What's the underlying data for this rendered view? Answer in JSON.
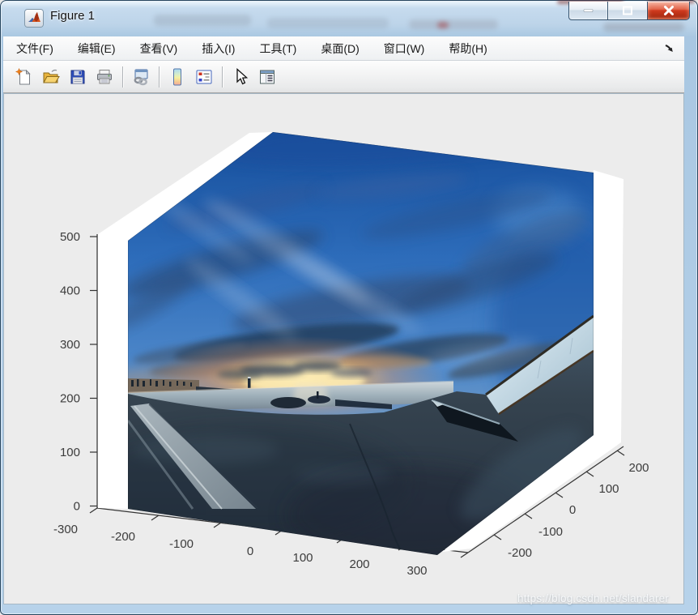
{
  "window": {
    "title": "Figure 1",
    "controls": [
      "minimize",
      "maximize",
      "close"
    ]
  },
  "menu": {
    "items": [
      "文件(F)",
      "编辑(E)",
      "查看(V)",
      "插入(I)",
      "工具(T)",
      "桌面(D)",
      "窗口(W)",
      "帮助(H)"
    ],
    "overflow_arrow": "↘"
  },
  "toolbar": {
    "icons": [
      "new-figure",
      "open-file",
      "save-figure",
      "print-figure",
      "link-plot",
      "insert-colorbar",
      "insert-legend",
      "edit-plot",
      "property-inspector"
    ]
  },
  "figure": {
    "view": "3d-surface-with-photo-texture",
    "axes": {
      "z_ticks": [
        "0",
        "100",
        "200",
        "300",
        "400",
        "500"
      ],
      "x_ticks": [
        "-300",
        "-200",
        "-100",
        "0",
        "100",
        "200",
        "300"
      ],
      "y_ticks": [
        "-200",
        "-100",
        "0",
        "100",
        "200"
      ]
    },
    "image_subject": "sunset sky over harbor with concrete breakwater foreground"
  },
  "watermark": "https://blog.csdn.net/slandarer",
  "colors": {
    "titlebar_blue": "#bdd4e9",
    "frame_blue": "#a9c7e2",
    "close_red": "#cf3a1e",
    "figure_gray": "#ececec",
    "toolbar_gray": "#f2f2f2",
    "menu_text": "#1a1a1a",
    "tick_text": "#3c3c3c",
    "sky_blue": "#2d6cba",
    "sunset_orange": "#f7bf6e",
    "ground_slate": "#35434f"
  }
}
